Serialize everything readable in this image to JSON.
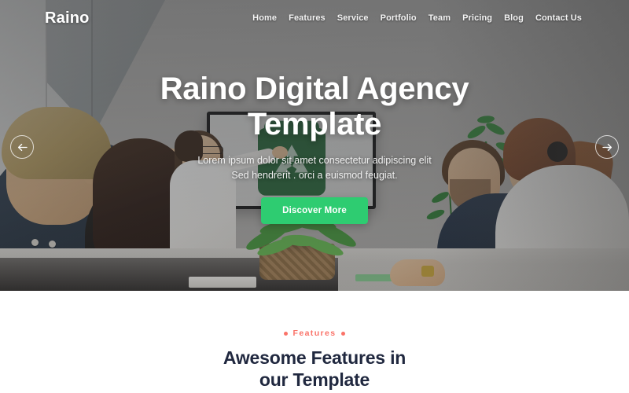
{
  "brand": {
    "logo": "Raino"
  },
  "nav": {
    "items": [
      {
        "label": "Home"
      },
      {
        "label": "Features"
      },
      {
        "label": "Service"
      },
      {
        "label": "Portfolio"
      },
      {
        "label": "Team"
      },
      {
        "label": "Pricing"
      },
      {
        "label": "Blog"
      },
      {
        "label": "Contact Us"
      }
    ]
  },
  "hero": {
    "title_line1": "Raino Digital Agency",
    "title_line2": "Template",
    "subtitle_line1": "Lorem ipsum dolor sit amet consectetur adipiscing elit",
    "subtitle_line2": "Sed hendrerit . orci a euismod feugiat.",
    "cta_label": "Discover More",
    "prev_icon": "arrow-left-icon",
    "next_icon": "arrow-right-icon",
    "overlay_color": "#2a2c2e",
    "cta_color": "#2ecc71"
  },
  "features": {
    "eyebrow": "Features",
    "title_line1": "Awesome Features in",
    "title_line2": "our Template",
    "accent_color": "#fa7268",
    "heading_color": "#20283f"
  }
}
